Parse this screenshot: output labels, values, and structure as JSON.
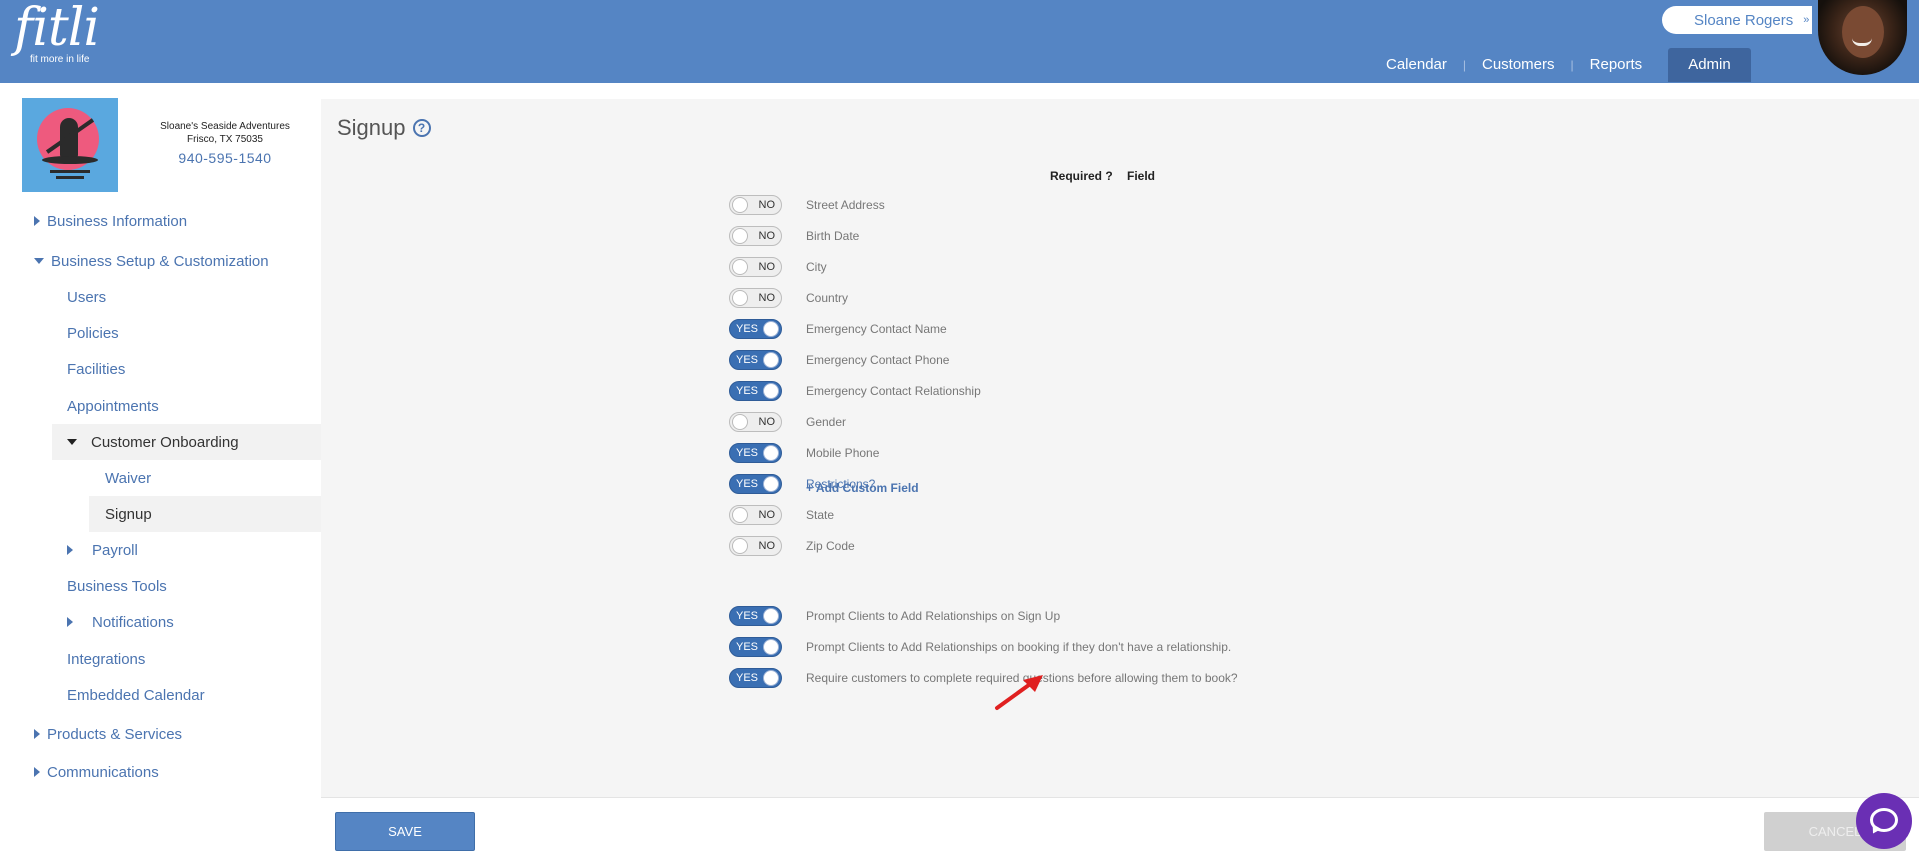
{
  "header": {
    "logo_text": "fitli",
    "logo_tagline": "fit more in life",
    "user_name": "Sloane Rogers",
    "nav": [
      "Calendar",
      "Customers",
      "Reports",
      "Admin"
    ],
    "brand_color": "#5585c4"
  },
  "business": {
    "name": "Sloane's Seaside Adventures",
    "location": "Frisco, TX 75035",
    "phone": "940-595-1540"
  },
  "sidebar": {
    "business_information": "Business Information",
    "business_setup": "Business Setup & Customization",
    "users": "Users",
    "policies": "Policies",
    "facilities": "Facilities",
    "appointments": "Appointments",
    "customer_onboarding": "Customer Onboarding",
    "waiver": "Waiver",
    "signup": "Signup",
    "payroll": "Payroll",
    "business_tools": "Business Tools",
    "notifications": "Notifications",
    "integrations": "Integrations",
    "embedded_calendar": "Embedded Calendar",
    "products_services": "Products & Services",
    "communications": "Communications"
  },
  "page": {
    "title": "Signup",
    "col_required": "Required ?",
    "col_field": "Field",
    "add_custom_field": "+ Add Custom Field",
    "fields": [
      {
        "state": "NO",
        "label": "Street Address"
      },
      {
        "state": "NO",
        "label": "Birth Date"
      },
      {
        "state": "NO",
        "label": "City"
      },
      {
        "state": "NO",
        "label": "Country"
      },
      {
        "state": "YES",
        "label": "Emergency Contact Name"
      },
      {
        "state": "YES",
        "label": "Emergency Contact Phone"
      },
      {
        "state": "YES",
        "label": "Emergency Contact Relationship"
      },
      {
        "state": "NO",
        "label": "Gender"
      },
      {
        "state": "YES",
        "label": "Mobile Phone"
      },
      {
        "state": "YES",
        "label": "Restrictions?"
      },
      {
        "state": "NO",
        "label": "State"
      },
      {
        "state": "NO",
        "label": "Zip Code"
      }
    ],
    "options": [
      {
        "state": "YES",
        "label": "Prompt Clients to Add Relationships on Sign Up"
      },
      {
        "state": "YES",
        "label": "Prompt Clients to Add Relationships on booking if they don't have a relationship."
      },
      {
        "state": "YES",
        "label": "Require customers to complete required questions before allowing them to book?"
      }
    ],
    "save_label": "SAVE",
    "cancel_label": "CANCEL"
  }
}
